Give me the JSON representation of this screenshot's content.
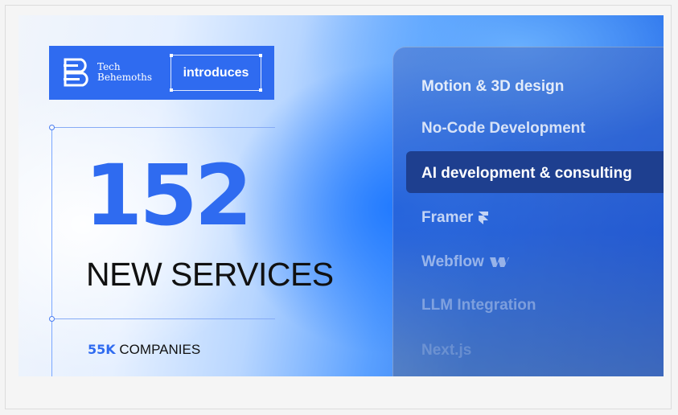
{
  "brand": {
    "name_line1": "Tech",
    "name_line2": "Behemoths",
    "tagline": "introduces"
  },
  "headline": {
    "number": "152",
    "subtitle": "NEW SERVICES"
  },
  "companies": {
    "number": "55K",
    "label": "COMPANIES"
  },
  "services": [
    {
      "label": "Motion & 3D design",
      "opacity": 0.85,
      "icon": ""
    },
    {
      "label": "No-Code Development",
      "opacity": 0.8,
      "icon": ""
    },
    {
      "label": "AI development & consulting",
      "opacity": 1.0,
      "active": true,
      "icon": ""
    },
    {
      "label": "Framer",
      "opacity": 0.7,
      "icon": "framer-icon"
    },
    {
      "label": "Webflow",
      "opacity": 0.5,
      "icon": "webflow-icon"
    },
    {
      "label": "LLM Integration",
      "opacity": 0.35,
      "icon": ""
    },
    {
      "label": "Next.js",
      "opacity": 0.2,
      "icon": ""
    }
  ],
  "colors": {
    "accent": "#2f6bf0",
    "active_row": "#1e3f8f",
    "text_dark": "#111111"
  }
}
